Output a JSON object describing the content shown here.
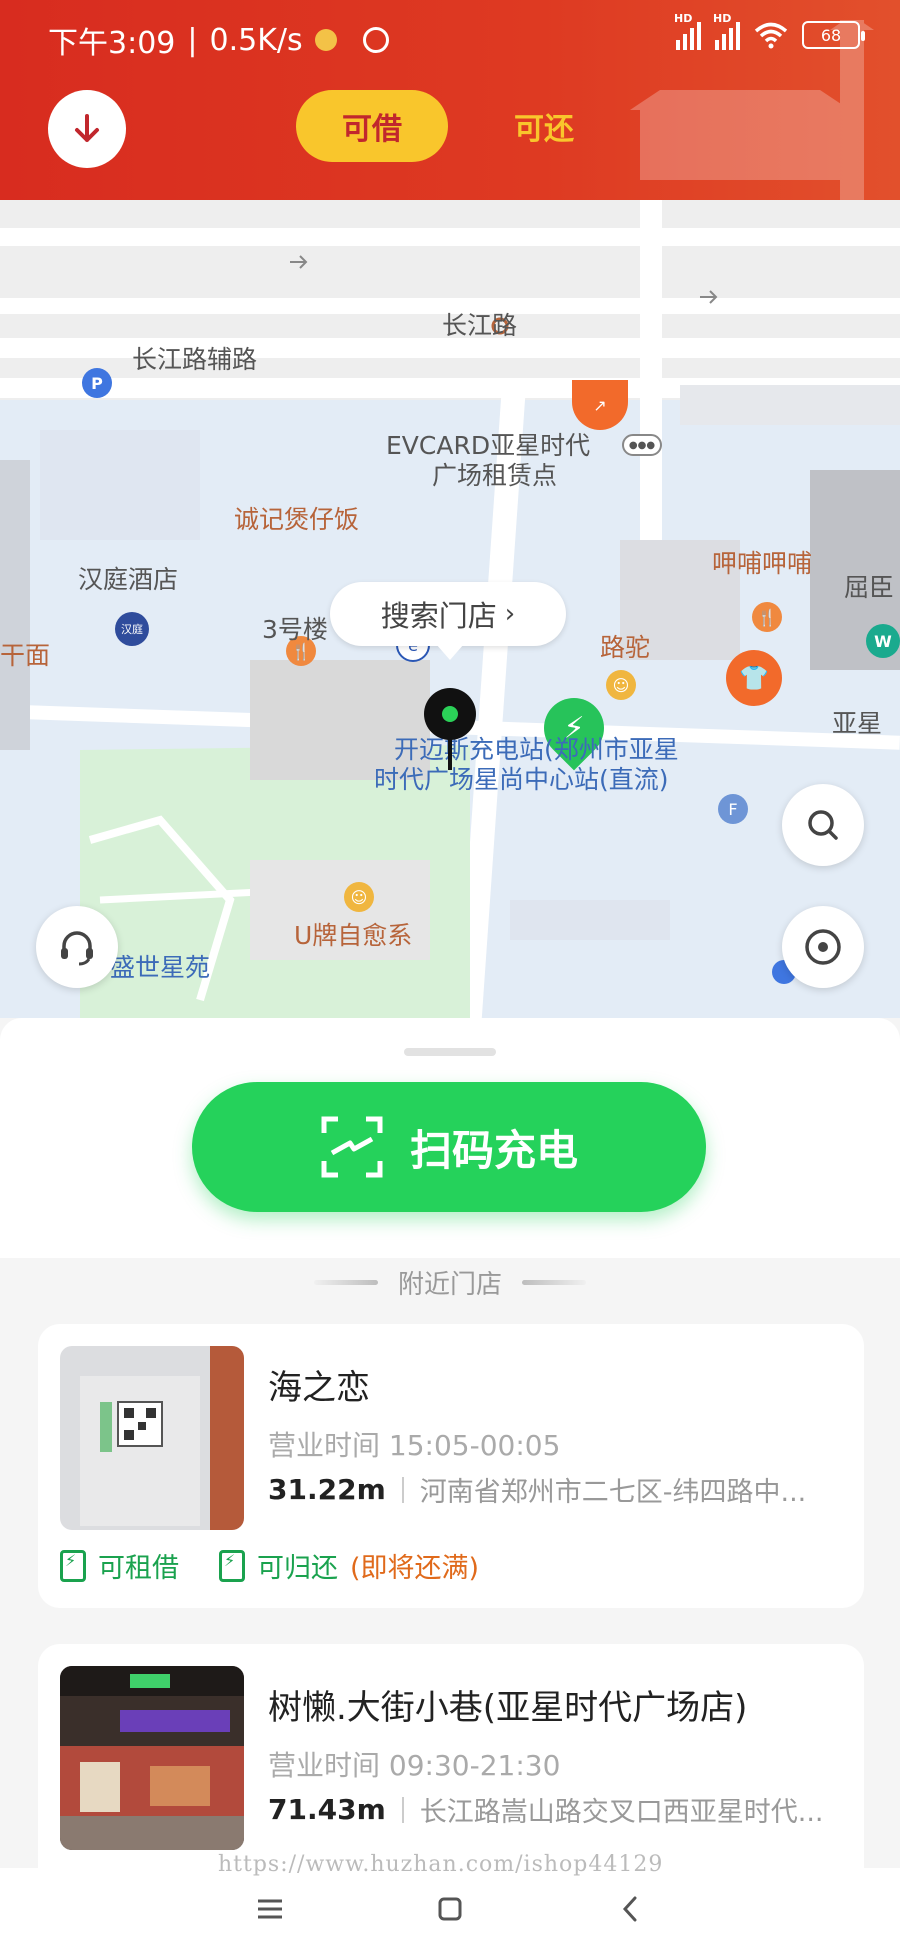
{
  "status_bar": {
    "time": "下午3:09",
    "speed": "0.5K/s",
    "network_1": "HD",
    "network_2": "HD",
    "battery": "68"
  },
  "header": {
    "tabs": [
      {
        "label": "可借",
        "active": true
      },
      {
        "label": "可还",
        "active": false
      }
    ]
  },
  "map": {
    "labels": {
      "changjiang_road": "长江路",
      "changjiang_aux": "长江路辅路",
      "evcard_1": "EVCARD亚星时代",
      "evcard_2": "广场租赁点",
      "chengji": "诚记煲仔饭",
      "hanting_logo": "汉庭",
      "hanting": "汉庭酒店",
      "building3": "3号楼",
      "lutuo": "路驼",
      "ganmian": "干面",
      "huahua": "呷哺呷哺",
      "qu": "屈臣",
      "yaxing": "亚星",
      "station_1": "开迈斯充电站(郑州市亚星",
      "station_2": "时代广场星尚中心站(直流)",
      "u_brand": "U牌自愈系",
      "shengshi": "盛世星苑"
    },
    "search_label": "搜索门店"
  },
  "scan_button": {
    "label": "扫码充电"
  },
  "nearby_title": "附近门店",
  "stores": [
    {
      "name": "海之恋",
      "hours": "营业时间 15:05-00:05",
      "distance": "31.22m",
      "address": "河南省郑州市二七区-纬四路中...",
      "badge_borrow": "可租借",
      "badge_return": "可归还",
      "return_note": "(即将还满)"
    },
    {
      "name": "树懒.大街小巷(亚星时代广场店)",
      "hours": "营业时间 09:30-21:30",
      "distance": "71.43m",
      "address": "长江路嵩山路交叉口西亚星时代..."
    }
  ],
  "watermark": "https://www.huzhan.com/ishop44129",
  "colors": {
    "header_red": "#d82c1f",
    "tab_yellow": "#f9c62c",
    "scan_green": "#25d25b",
    "available_green": "#1aa24e",
    "note_orange": "#e06a1b"
  },
  "icons": [
    "download-icon",
    "search-icon",
    "locate-icon",
    "headset-icon",
    "scan-icon",
    "map-pin-icon"
  ]
}
